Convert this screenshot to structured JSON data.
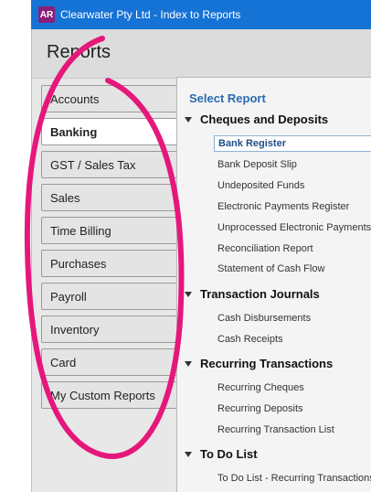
{
  "window": {
    "app_badge": "AR",
    "title": "Clearwater Pty Ltd - Index to Reports"
  },
  "header": {
    "title": "Reports"
  },
  "nav": {
    "items": [
      {
        "label": "Accounts"
      },
      {
        "label": "Banking"
      },
      {
        "label": "GST / Sales Tax"
      },
      {
        "label": "Sales"
      },
      {
        "label": "Time Billing"
      },
      {
        "label": "Purchases"
      },
      {
        "label": "Payroll"
      },
      {
        "label": "Inventory"
      },
      {
        "label": "Card"
      },
      {
        "label": "My Custom Reports"
      }
    ],
    "active": "Banking"
  },
  "report_panel": {
    "title": "Select Report",
    "groups": [
      {
        "label": "Cheques and Deposits",
        "items": [
          "Bank Register",
          "Bank Deposit Slip",
          "Undeposited Funds",
          "Electronic Payments Register",
          "Unprocessed Electronic Payments",
          "Reconciliation Report",
          "Statement of Cash Flow"
        ]
      },
      {
        "label": "Transaction Journals",
        "items": [
          "Cash Disbursements",
          "Cash Receipts"
        ]
      },
      {
        "label": "Recurring Transactions",
        "items": [
          "Recurring Cheques",
          "Recurring Deposits",
          "Recurring Transaction List"
        ]
      },
      {
        "label": "To Do List",
        "items": [
          "To Do List - Recurring Transactions"
        ]
      }
    ],
    "selected_item": "Bank Register"
  },
  "colors": {
    "titlebar": "#1673d6",
    "accent_title": "#2a6ab0",
    "highlight_annotation": "#e5177a"
  }
}
